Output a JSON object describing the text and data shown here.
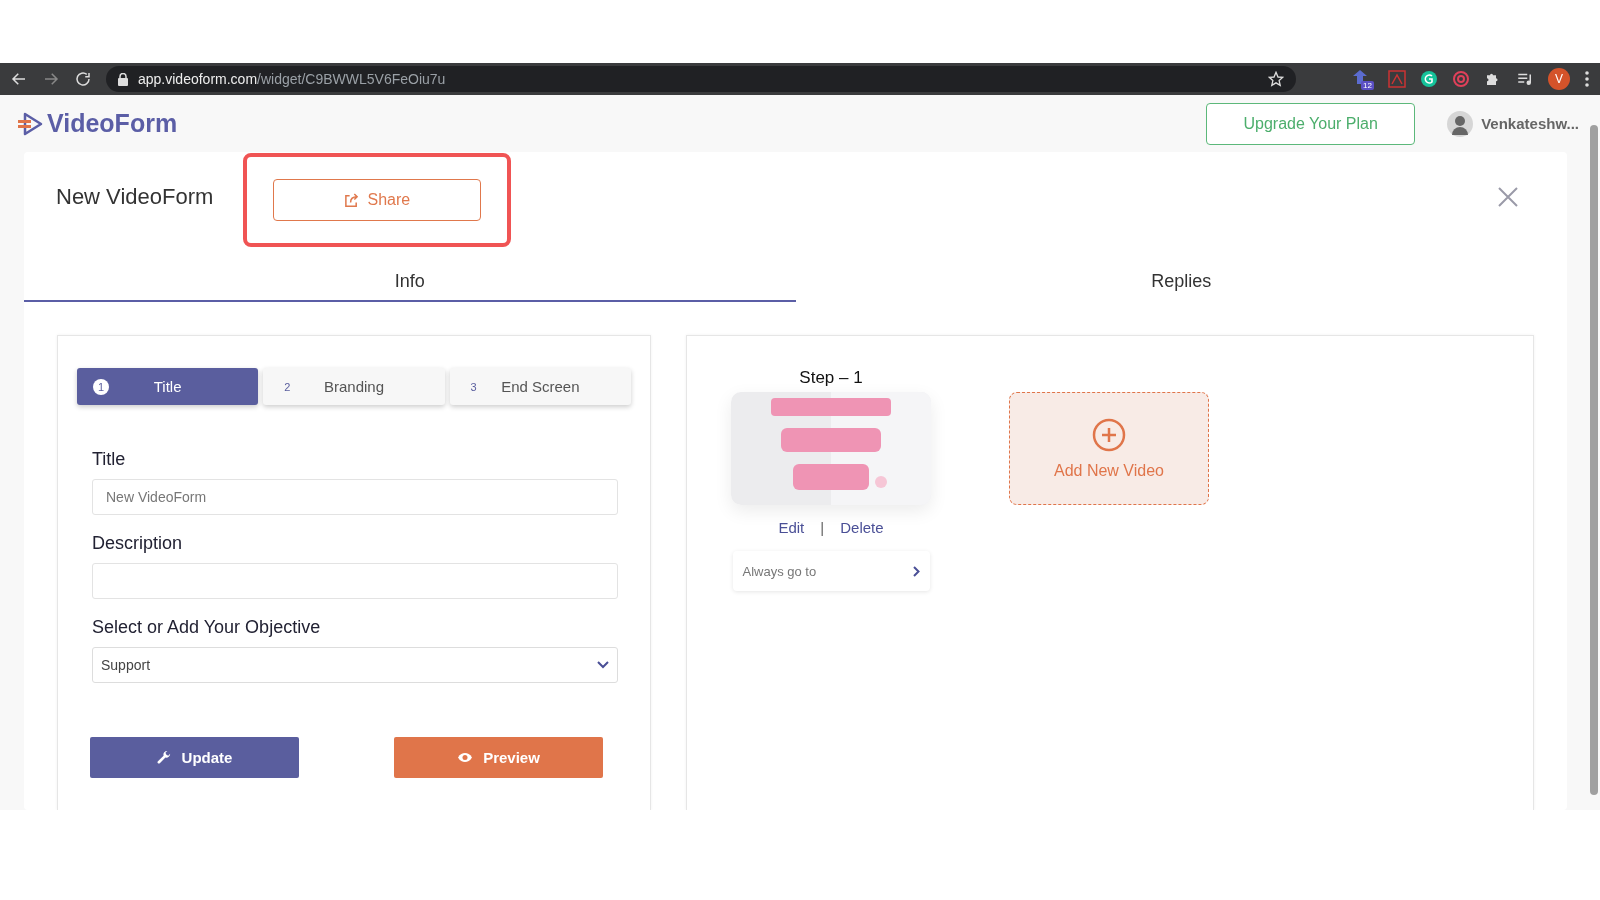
{
  "browser": {
    "url_host": "app.videoform.com",
    "url_path": "/widget/C9BWWL5V6FeOiu7u",
    "extension_badge": "12",
    "profile_initial": "V"
  },
  "header": {
    "logo": "VideoForm",
    "upgrade_button": "Upgrade Your Plan",
    "user_name": "Venkateshw..."
  },
  "form": {
    "title": "New VideoForm",
    "share_button": "Share",
    "share_highlighted": true
  },
  "tabs": [
    {
      "label": "Info",
      "selected": true
    },
    {
      "label": "Replies",
      "selected": false
    }
  ],
  "steps": [
    {
      "number": "1",
      "label": "Title",
      "selected": true
    },
    {
      "number": "2",
      "label": "Branding",
      "selected": false
    },
    {
      "number": "3",
      "label": "End Screen",
      "selected": false
    }
  ],
  "fields": [
    {
      "label": "Title",
      "kind": "text",
      "value": "New VideoForm"
    },
    {
      "label": "Description",
      "kind": "text"
    },
    {
      "label": "Select or Add Your Objective",
      "kind": "select",
      "value": "Support"
    }
  ],
  "buttons": [
    {
      "label": "Update",
      "kind": "primary"
    },
    {
      "label": "Preview",
      "kind": "accent"
    }
  ],
  "video_step": {
    "title": "Step – 1",
    "thumbnail": {
      "kind": "picture"
    },
    "links": [
      "Edit",
      "Delete"
    ],
    "separator": "|",
    "route": "Always go to",
    "add_video": "Add New Video"
  }
}
